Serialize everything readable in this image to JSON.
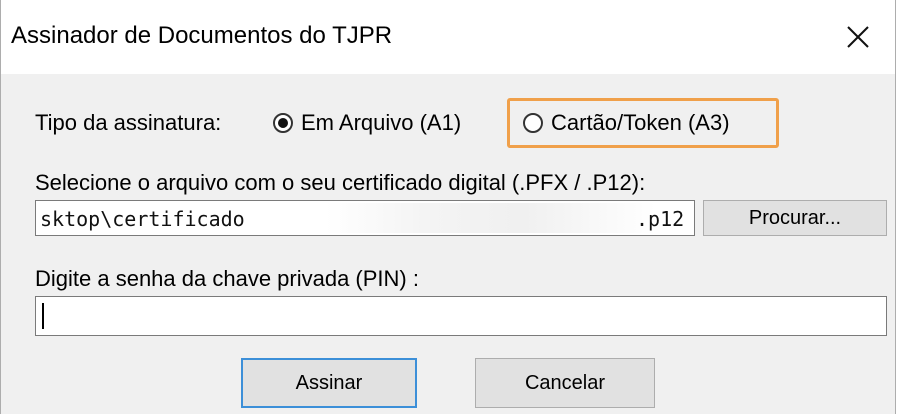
{
  "window": {
    "title": "Assinador de Documentos do TJPR",
    "close_icon": "close-icon"
  },
  "signature_type": {
    "label": "Tipo da assinatura:",
    "options": [
      {
        "label": "Em Arquivo (A1)",
        "checked": true
      },
      {
        "label": "Cartão/Token (A3)",
        "checked": false
      }
    ],
    "highlight_color": "#f0a04a"
  },
  "certificate": {
    "label": "Selecione o arquivo com o seu certificado digital (.PFX / .P12):",
    "path_prefix": "sktop\\certificado",
    "path_suffix": ".p12",
    "browse_label": "Procurar..."
  },
  "pin": {
    "label": "Digite a senha da chave privada (PIN) :",
    "value": ""
  },
  "actions": {
    "sign_label": "Assinar",
    "cancel_label": "Cancelar"
  }
}
